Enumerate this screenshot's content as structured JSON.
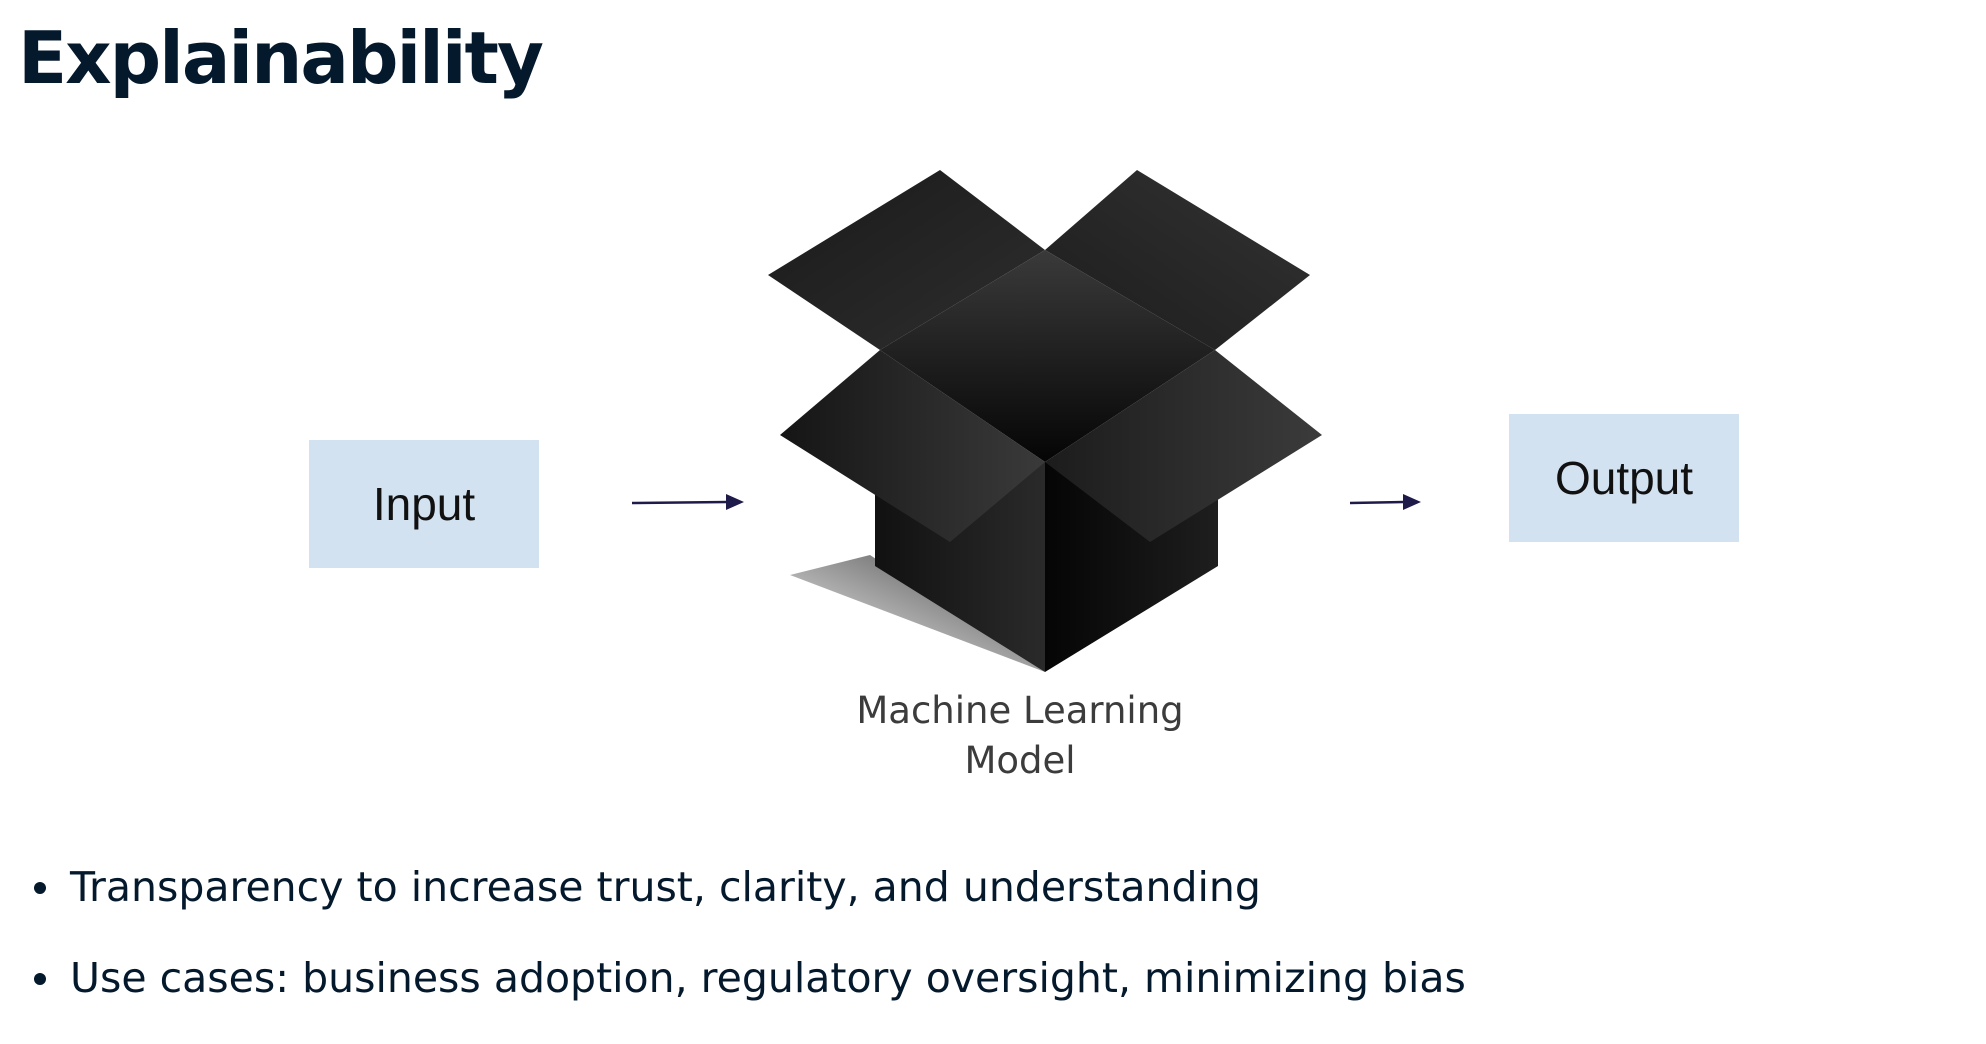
{
  "slide": {
    "title": "Explainability"
  },
  "diagram": {
    "input_label": "Input",
    "output_label": "Output",
    "model_label_line1": "Machine Learning",
    "model_label_line2": "Model"
  },
  "bullets": [
    "Transparency to increase trust, clarity, and understanding",
    "Use cases: business adoption, regulatory oversight, minimizing bias"
  ],
  "colors": {
    "title_text": "#05192d",
    "box_fill": "#d3e2f1",
    "arrow": "#1e1a4a"
  }
}
